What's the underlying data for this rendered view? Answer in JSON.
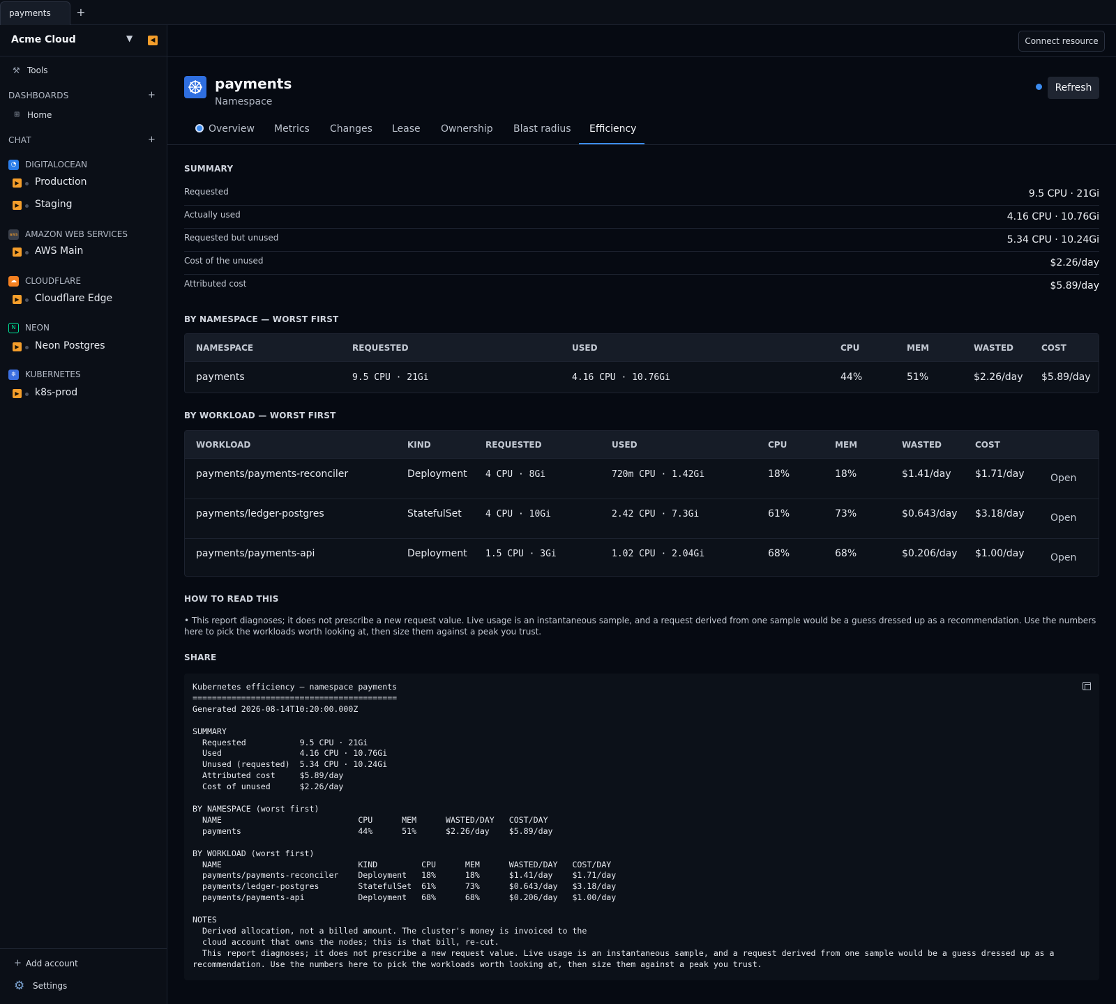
{
  "tab_strip": {
    "tab_label": "payments",
    "add": "+"
  },
  "sidebar": {
    "org": "Acme Cloud",
    "tools": "Tools",
    "dashboards_label": "DASHBOARDS",
    "home": "Home",
    "chat_label": "CHAT",
    "providers": [
      {
        "name": "DIGITALOCEAN",
        "icon": "digitalocean-icon",
        "color": "#2b7de9",
        "resources": [
          "Production",
          "Staging"
        ]
      },
      {
        "name": "AMAZON WEB SERVICES",
        "icon": "aws-icon",
        "color": "#3a3f4a",
        "resources": [
          "AWS Main"
        ]
      },
      {
        "name": "CLOUDFLARE",
        "icon": "cloudflare-icon",
        "color": "#f38020",
        "resources": [
          "Cloudflare Edge"
        ]
      },
      {
        "name": "NEON",
        "icon": "neon-icon",
        "color": "#00e599",
        "resources": [
          "Neon Postgres"
        ]
      },
      {
        "name": "KUBERNETES",
        "icon": "kubernetes-icon",
        "color": "#3b6fe0",
        "resources": [
          "k8s-prod"
        ]
      }
    ],
    "add_account": "Add account",
    "settings": "Settings"
  },
  "topbar": {
    "connect": "Connect resource"
  },
  "resource": {
    "name": "payments",
    "type": "Namespace",
    "refresh": "Refresh"
  },
  "tabs": [
    "Overview",
    "Metrics",
    "Changes",
    "Lease",
    "Ownership",
    "Blast radius",
    "Efficiency"
  ],
  "summary": {
    "title": "SUMMARY",
    "rows": [
      {
        "key": "Requested",
        "value": "9.5 CPU · 21Gi"
      },
      {
        "key": "Actually used",
        "value": "4.16 CPU · 10.76Gi"
      },
      {
        "key": "Requested but unused",
        "value": "5.34 CPU · 10.24Gi"
      },
      {
        "key": "Cost of the unused",
        "value": "$2.26/day"
      },
      {
        "key": "Attributed cost",
        "value": "$5.89/day"
      }
    ]
  },
  "by_namespace": {
    "title": "BY NAMESPACE — WORST FIRST",
    "headers": [
      "NAMESPACE",
      "REQUESTED",
      "USED",
      "CPU",
      "MEM",
      "WASTED",
      "COST"
    ],
    "rows": [
      [
        "payments",
        "9.5 CPU · 21Gi",
        "4.16 CPU · 10.76Gi",
        "44%",
        "51%",
        "$2.26/day",
        "$5.89/day"
      ]
    ]
  },
  "by_workload": {
    "title": "BY WORKLOAD — WORST FIRST",
    "headers": [
      "WORKLOAD",
      "KIND",
      "REQUESTED",
      "USED",
      "CPU",
      "MEM",
      "WASTED",
      "COST"
    ],
    "open_label": "Open",
    "rows": [
      [
        "payments/payments-reconciler",
        "Deployment",
        "4 CPU · 8Gi",
        "720m CPU · 1.42Gi",
        "18%",
        "18%",
        "$1.41/day",
        "$1.71/day"
      ],
      [
        "payments/ledger-postgres",
        "StatefulSet",
        "4 CPU · 10Gi",
        "2.42 CPU · 7.3Gi",
        "61%",
        "73%",
        "$0.643/day",
        "$3.18/day"
      ],
      [
        "payments/payments-api",
        "Deployment",
        "1.5 CPU · 3Gi",
        "1.02 CPU · 2.04Gi",
        "68%",
        "68%",
        "$0.206/day",
        "$1.00/day"
      ]
    ]
  },
  "how_to_read": {
    "title": "HOW TO READ THIS",
    "text": "• This report diagnoses; it does not prescribe a new request value. Live usage is an instantaneous sample, and a request derived from one sample would be a guess dressed up as a recommendation. Use the numbers here to pick the workloads worth looking at, then size them against a peak you trust."
  },
  "share": {
    "title": "SHARE",
    "text": "Kubernetes efficiency — namespace payments\n==========================================\nGenerated 2026-08-14T10:20:00.000Z\n\nSUMMARY\n  Requested           9.5 CPU · 21Gi\n  Used                4.16 CPU · 10.76Gi\n  Unused (requested)  5.34 CPU · 10.24Gi\n  Attributed cost     $5.89/day\n  Cost of unused      $2.26/day\n\nBY NAMESPACE (worst first)\n  NAME                            CPU      MEM      WASTED/DAY   COST/DAY\n  payments                        44%      51%      $2.26/day    $5.89/day\n\nBY WORKLOAD (worst first)\n  NAME                            KIND         CPU      MEM      WASTED/DAY   COST/DAY\n  payments/payments-reconciler    Deployment   18%      18%      $1.41/day    $1.71/day\n  payments/ledger-postgres        StatefulSet  61%      73%      $0.643/day   $3.18/day\n  payments/payments-api           Deployment   68%      68%      $0.206/day   $1.00/day\n\nNOTES\n  Derived allocation, not a billed amount. The cluster's money is invoiced to the\n  cloud account that owns the nodes; this is that bill, re-cut.\n  This report diagnoses; it does not prescribe a new request value. Live usage is an instantaneous sample, and a request derived from one sample would be a guess dressed up as a recommendation. Use the numbers here to pick the workloads worth looking at, then size them against a peak you trust."
  }
}
